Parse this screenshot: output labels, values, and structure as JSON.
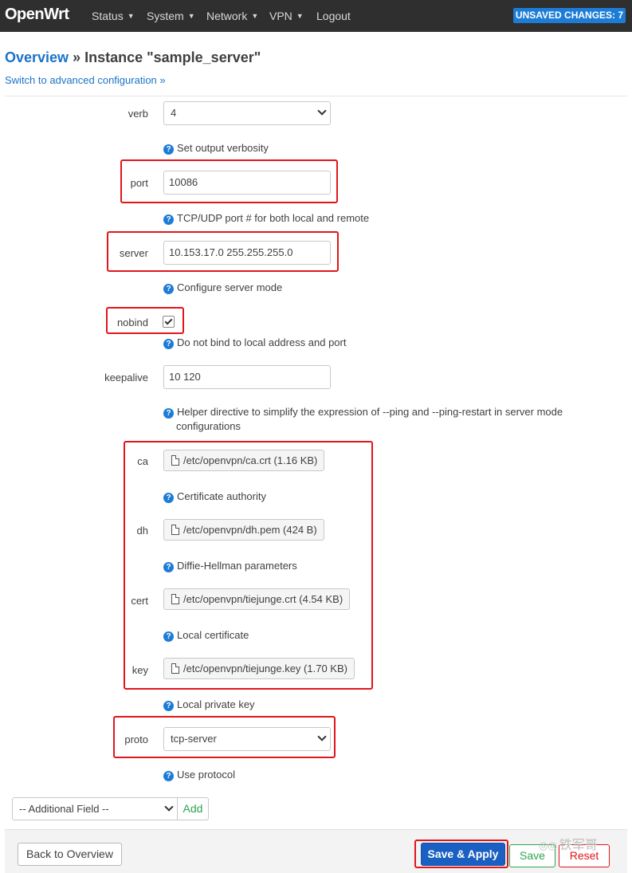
{
  "header": {
    "brand": "OpenWrt",
    "menu": [
      {
        "label": "Status",
        "has_caret": true
      },
      {
        "label": "System",
        "has_caret": true
      },
      {
        "label": "Network",
        "has_caret": true
      },
      {
        "label": "VPN",
        "has_caret": true
      },
      {
        "label": "Logout",
        "has_caret": false
      }
    ],
    "unsaved_badge": "UNSAVED CHANGES: 7"
  },
  "page": {
    "breadcrumb_link": "Overview",
    "breadcrumb_sep": " » ",
    "title": "Instance \"sample_server\"",
    "advanced_link": "Switch to advanced configuration »"
  },
  "fields": {
    "verb": {
      "label": "verb",
      "value": "4",
      "help": "Set output verbosity"
    },
    "port": {
      "label": "port",
      "value": "10086",
      "help": "TCP/UDP port # for both local and remote"
    },
    "server": {
      "label": "server",
      "value": "10.153.17.0 255.255.255.0",
      "help": "Configure server mode"
    },
    "nobind": {
      "label": "nobind",
      "checked": true,
      "help": "Do not bind to local address and port"
    },
    "keepalive": {
      "label": "keepalive",
      "value": "10 120",
      "help": "Helper directive to simplify the expression of --ping and --ping-restart in server mode",
      "help_line2": "configurations"
    },
    "ca": {
      "label": "ca",
      "file": "/etc/openvpn/ca.crt (1.16 KB)",
      "help": "Certificate authority"
    },
    "dh": {
      "label": "dh",
      "file": "/etc/openvpn/dh.pem (424 B)",
      "help": "Diffie-Hellman parameters"
    },
    "cert": {
      "label": "cert",
      "file": "/etc/openvpn/tiejunge.crt (4.54 KB)",
      "help": "Local certificate"
    },
    "key": {
      "label": "key",
      "file": "/etc/openvpn/tiejunge.key (1.70 KB)",
      "help": "Local private key"
    },
    "proto": {
      "label": "proto",
      "value": "tcp-server",
      "help": "Use protocol"
    }
  },
  "additional": {
    "select_value": "-- Additional Field --",
    "add_label": "Add"
  },
  "footer": {
    "back_label": "Back to Overview",
    "save_apply_label": "Save & Apply",
    "save_label": "Save",
    "reset_label": "Reset"
  },
  "watermark": "铁军哥",
  "colors": {
    "topbar": "#2f2f2f",
    "accent": "#1d7cd6",
    "highlight_box": "#e0161b",
    "save_green": "#2ea44f"
  }
}
